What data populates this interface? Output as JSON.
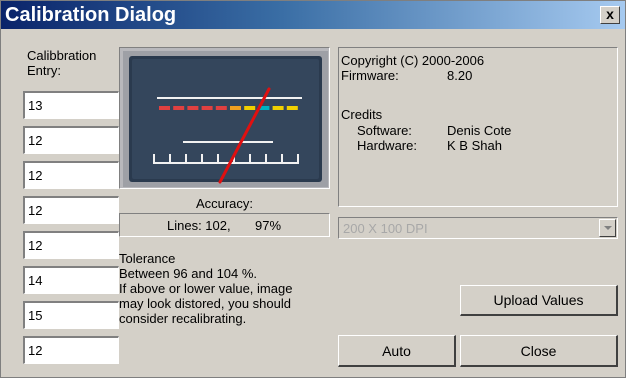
{
  "window": {
    "title": "Calibration Dialog",
    "close_label": "x"
  },
  "entries": {
    "label_line1": "Calibbration",
    "label_line2": "Entry:",
    "values": [
      "13",
      "12",
      "12",
      "12",
      "12",
      "14",
      "15",
      "12"
    ]
  },
  "meter": {
    "needle_color": "#e01010",
    "led_colors": [
      "#e04040",
      "#e04040",
      "#e04040",
      "#e04040",
      "#e04040",
      "#f0a020",
      "#f0d000",
      "#00b0c0",
      "#f0d000",
      "#f0d000"
    ]
  },
  "accuracy": {
    "label": "Accuracy:",
    "lines_text": "Lines: 102,",
    "percent_text": "97%"
  },
  "info": {
    "copyright": "Copyright (C) 2000-2006",
    "firmware_label": "Firmware:",
    "firmware_value": "8.20",
    "credits_label": "Credits",
    "software_label": "Software:",
    "software_value": "Denis Cote",
    "hardware_label": "Hardware:",
    "hardware_value": "K B Shah"
  },
  "dpi": {
    "selected": "200 X 100 DPI"
  },
  "tolerance": {
    "heading": "Tolerance",
    "line1": "Between 96 and 104 %.",
    "line2": "If above or lower value, image",
    "line3": "may look distored, you should",
    "line4": "consider recalibrating."
  },
  "buttons": {
    "upload": "Upload Values",
    "auto": "Auto",
    "close": "Close"
  }
}
